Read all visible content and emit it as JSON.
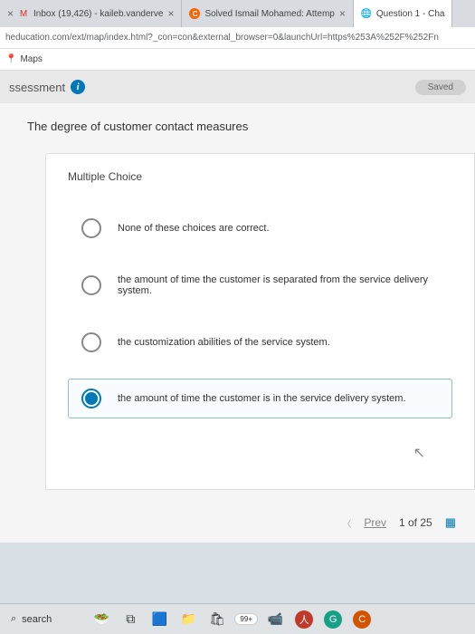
{
  "tabs": [
    {
      "label": "Inbox (19,426) - kaileb.vanderve"
    },
    {
      "label": "Solved Ismail Mohamed: Attemp"
    },
    {
      "label": "Question 1 - Cha"
    }
  ],
  "url": "heducation.com/ext/map/index.html?_con=con&external_browser=0&launchUrl=https%253A%252F%252Fn",
  "bookmark": {
    "label": "Maps"
  },
  "assessment": {
    "label": "ssessment",
    "status": "Saved"
  },
  "question": {
    "prompt": "The degree of customer contact measures",
    "type_label": "Multiple Choice",
    "options": [
      "None of these choices are correct.",
      "the amount of time the customer is separated from the service delivery system.",
      "the customization abilities of the service system.",
      "the amount of time the customer is in the service delivery system."
    ],
    "selected_index": 3
  },
  "nav": {
    "prev": "Prev",
    "position": "1 of 25"
  },
  "taskbar": {
    "search": "search",
    "badge": "99+"
  }
}
